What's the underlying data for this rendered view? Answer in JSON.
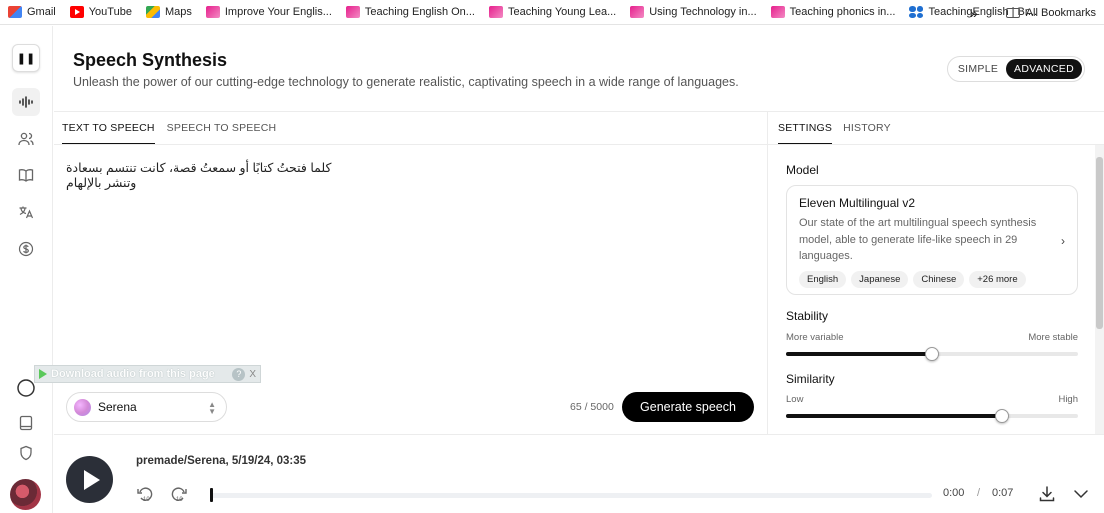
{
  "bookmarks": [
    {
      "label": "Gmail",
      "icon": "gmail-icon"
    },
    {
      "label": "YouTube",
      "icon": "youtube-icon"
    },
    {
      "label": "Maps",
      "icon": "maps-icon"
    },
    {
      "label": "Improve Your Englis...",
      "icon": "teachingenglish-icon"
    },
    {
      "label": "Teaching English On...",
      "icon": "teachingenglish-icon"
    },
    {
      "label": "Teaching Young Lea...",
      "icon": "teachingenglish-icon"
    },
    {
      "label": "Using Technology in...",
      "icon": "teachingenglish-icon"
    },
    {
      "label": "Teaching phonics in...",
      "icon": "teachingenglish-icon"
    },
    {
      "label": "TeachingEnglish | Br...",
      "icon": "britishcouncil-icon"
    }
  ],
  "bookmarks_right": {
    "more": "»",
    "all": "All Bookmarks"
  },
  "header": {
    "title": "Speech Synthesis",
    "subtitle": "Unleash the power of our cutting-edge technology to generate realistic, captivating speech in a wide range of languages.",
    "mode_simple": "SIMPLE",
    "mode_advanced": "ADVANCED"
  },
  "main_tabs": [
    "TEXT TO SPEECH",
    "SPEECH TO SPEECH"
  ],
  "editor": {
    "text": "كلما فتحتُ كتابًا أو سمعتُ قصة، كانت تنتسم بسعادة وتنشر بالإلهام"
  },
  "download_bar": {
    "label": "Download audio from this page",
    "help": "?",
    "close": "X"
  },
  "voice": {
    "name": "Serena"
  },
  "char_count": "65 / 5000",
  "generate_label": "Generate speech",
  "settings": {
    "tabs": [
      "SETTINGS",
      "HISTORY"
    ],
    "model_label": "Model",
    "model": {
      "name": "Eleven Multilingual v2",
      "description": "Our state of the art multilingual speech synthesis model, able to generate life-like speech in 29 languages.",
      "languages": [
        "English",
        "Japanese",
        "Chinese",
        "+26 more"
      ]
    },
    "stability": {
      "label": "Stability",
      "min_label": "More variable",
      "max_label": "More stable",
      "value": 0.5
    },
    "similarity": {
      "label": "Similarity",
      "min_label": "Low",
      "max_label": "High",
      "value": 0.74
    }
  },
  "player": {
    "track": "premade/Serena, 5/19/24, 03:35",
    "current_time": "0:00",
    "separator": "/",
    "duration": "0:07",
    "progress": 0
  }
}
